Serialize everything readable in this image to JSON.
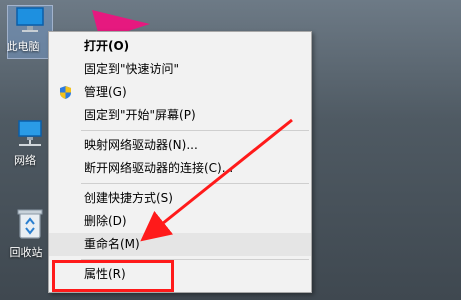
{
  "desktop": {
    "icons": [
      {
        "label": "此电脑",
        "icon": "computer-icon"
      },
      {
        "label": "网络",
        "icon": "network-icon"
      },
      {
        "label": "回收站",
        "icon": "recycle-bin-icon"
      }
    ]
  },
  "context_menu": {
    "items": [
      {
        "label": "打开(O)",
        "bold": true
      },
      {
        "label": "固定到\"快速访问\""
      },
      {
        "label": "管理(G)",
        "icon": "shield-icon"
      },
      {
        "label": "固定到\"开始\"屏幕(P)"
      },
      {
        "label": "映射网络驱动器(N)..."
      },
      {
        "label": "断开网络驱动器的连接(C)..."
      },
      {
        "label": "创建快捷方式(S)"
      },
      {
        "label": "删除(D)"
      },
      {
        "label": "重命名(M)"
      },
      {
        "label": "属性(R)"
      }
    ]
  },
  "colors": {
    "annotation": "#ff1a1a",
    "menu_bg": "#f2f2f2"
  }
}
